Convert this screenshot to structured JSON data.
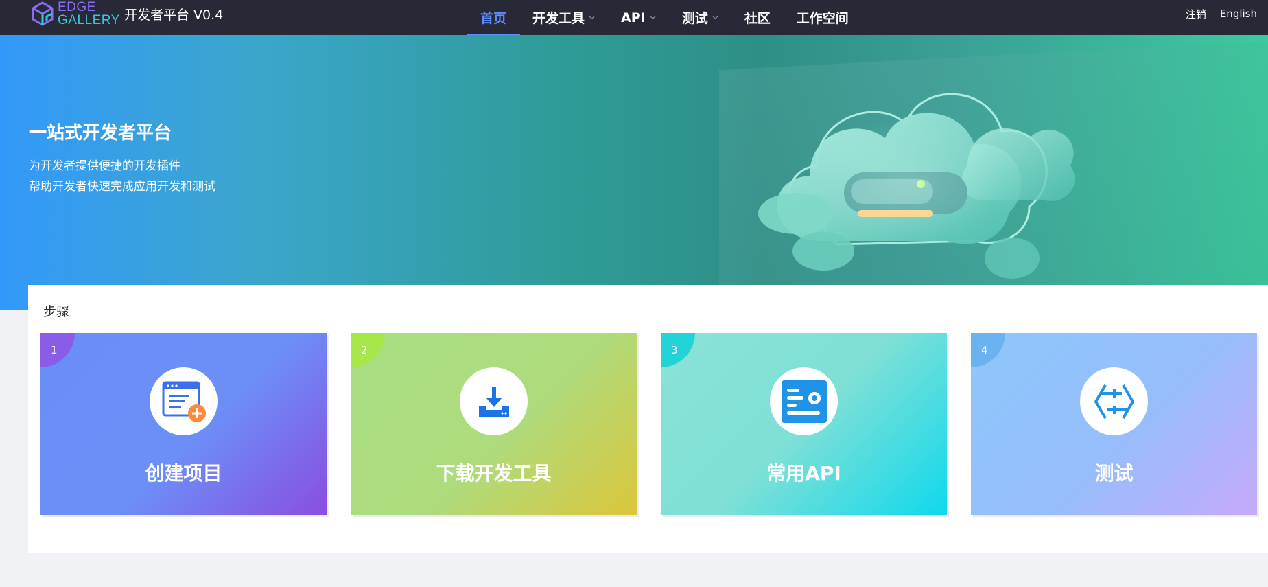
{
  "header": {
    "logo_line1": "EDGE",
    "logo_line2": "GALLERY",
    "platform_title": "开发者平台 V0.4",
    "nav": [
      {
        "label": "首页",
        "active": true
      },
      {
        "label": "开发工具",
        "dropdown": true
      },
      {
        "label": "API",
        "dropdown": true
      },
      {
        "label": "测试",
        "dropdown": true
      },
      {
        "label": "社区"
      },
      {
        "label": "工作空间"
      }
    ],
    "logout": "注销",
    "language": "English"
  },
  "hero": {
    "title": "一站式开发者平台",
    "subtitle1": "为开发者提供便捷的开发插件",
    "subtitle2": "帮助开发者快速完成应用开发和测试"
  },
  "steps": {
    "title": "步骤",
    "cards": [
      {
        "num": "1",
        "label": "创建项目",
        "icon": "create-project-icon"
      },
      {
        "num": "2",
        "label": "下载开发工具",
        "icon": "download-icon"
      },
      {
        "num": "3",
        "label": "常用API",
        "icon": "api-icon"
      },
      {
        "num": "4",
        "label": "测试",
        "icon": "test-icon"
      }
    ]
  },
  "colors": {
    "nav_bg": "#272a36",
    "nav_active": "#5f8cff",
    "accent_blue": "#3399fa",
    "accent_teal": "#3ccaa0"
  }
}
